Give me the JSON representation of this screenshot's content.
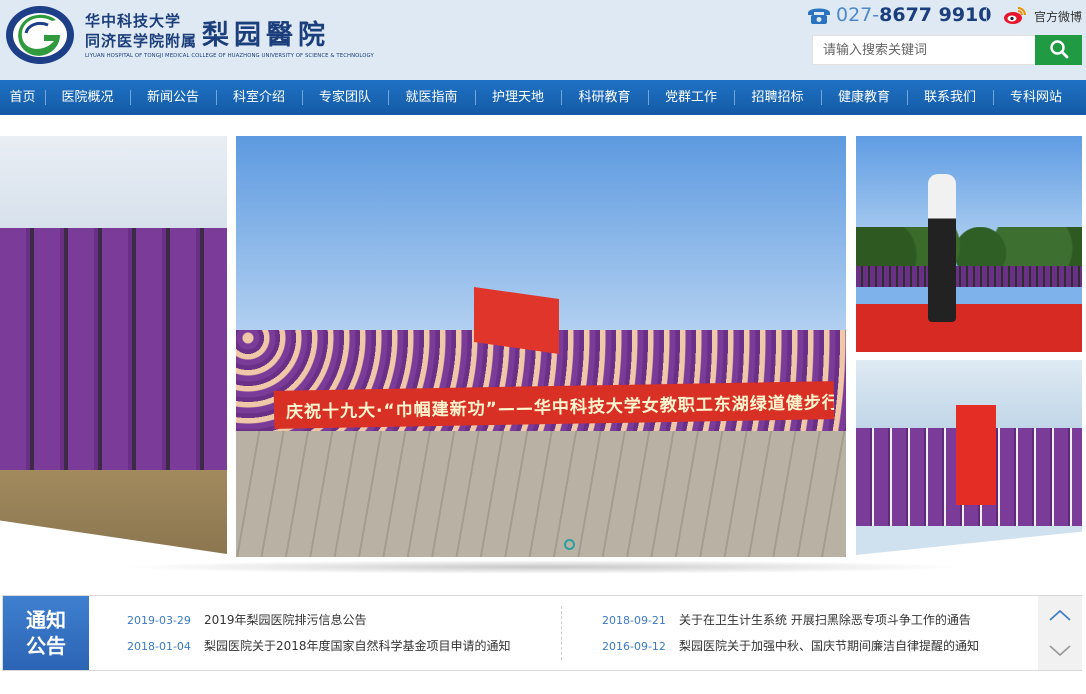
{
  "header": {
    "logo_cn_line1": "华中科技大学",
    "logo_cn_line2": "同济医学院附属",
    "logo_name": "梨园醫院",
    "logo_en": "LIYUAN HOSPITAL OF TONGJI MEDICAL COLLEGE OF HUAZHONG UNIVERSITY OF SCIENCE & TECHNOLOGY",
    "phone_area": "027-",
    "phone_number": "8677 9910",
    "weibo_label": "官方微博",
    "search_placeholder": "请输入搜索关键词",
    "colors": {
      "brand_blue": "#1b3e7c",
      "search_green": "#219b43"
    }
  },
  "nav": {
    "items": [
      "首页",
      "医院概况",
      "新闻公告",
      "科室介绍",
      "专家团队",
      "就医指南",
      "护理天地",
      "科研教育",
      "党群工作",
      "招聘招标",
      "健康教育",
      "联系我们",
      "专科网站"
    ]
  },
  "banner": {
    "slogan": "庆祝十九大·“巾帼建新功”——华中科技大学女教职工东湖绿道健步行活动",
    "active_slide": 1
  },
  "notice": {
    "label_line1": "通知",
    "label_line2": "公告",
    "items": [
      {
        "date": "2019-03-29",
        "title": "2019年梨园医院排污信息公告"
      },
      {
        "date": "2018-09-21",
        "title": "关于在卫生计生系统 开展扫黑除恶专项斗争工作的通告"
      },
      {
        "date": "2018-01-04",
        "title": "梨园医院关于2018年度国家自然科学基金项目申请的通知"
      },
      {
        "date": "2016-09-12",
        "title": "梨园医院关于加强中秋、国庆节期间廉洁自律提醒的通知"
      }
    ],
    "arrow_icons": [
      "chevron-up-icon",
      "chevron-down-icon"
    ]
  }
}
